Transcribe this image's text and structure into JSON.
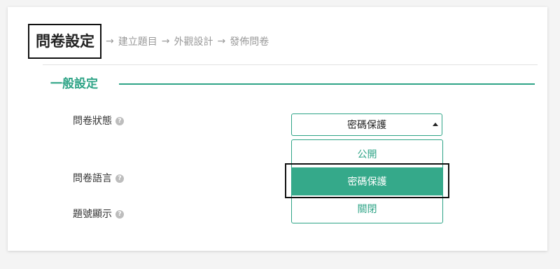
{
  "steps": {
    "current": "問卷設定",
    "arrow": "→",
    "items": [
      "建立題目",
      "外觀設計",
      "發佈問卷"
    ]
  },
  "section": {
    "title": "一般設定"
  },
  "fields": [
    {
      "label": "問卷狀態",
      "help": "?"
    },
    {
      "label": "問卷語言",
      "help": "?"
    },
    {
      "label": "題號顯示",
      "help": "?"
    }
  ],
  "status_select": {
    "value": "密碼保護",
    "options": [
      "公開",
      "密碼保護",
      "關閉"
    ],
    "selected_index": 1
  },
  "colors": {
    "accent": "#2fa487",
    "selected_bg": "#35a98a"
  }
}
